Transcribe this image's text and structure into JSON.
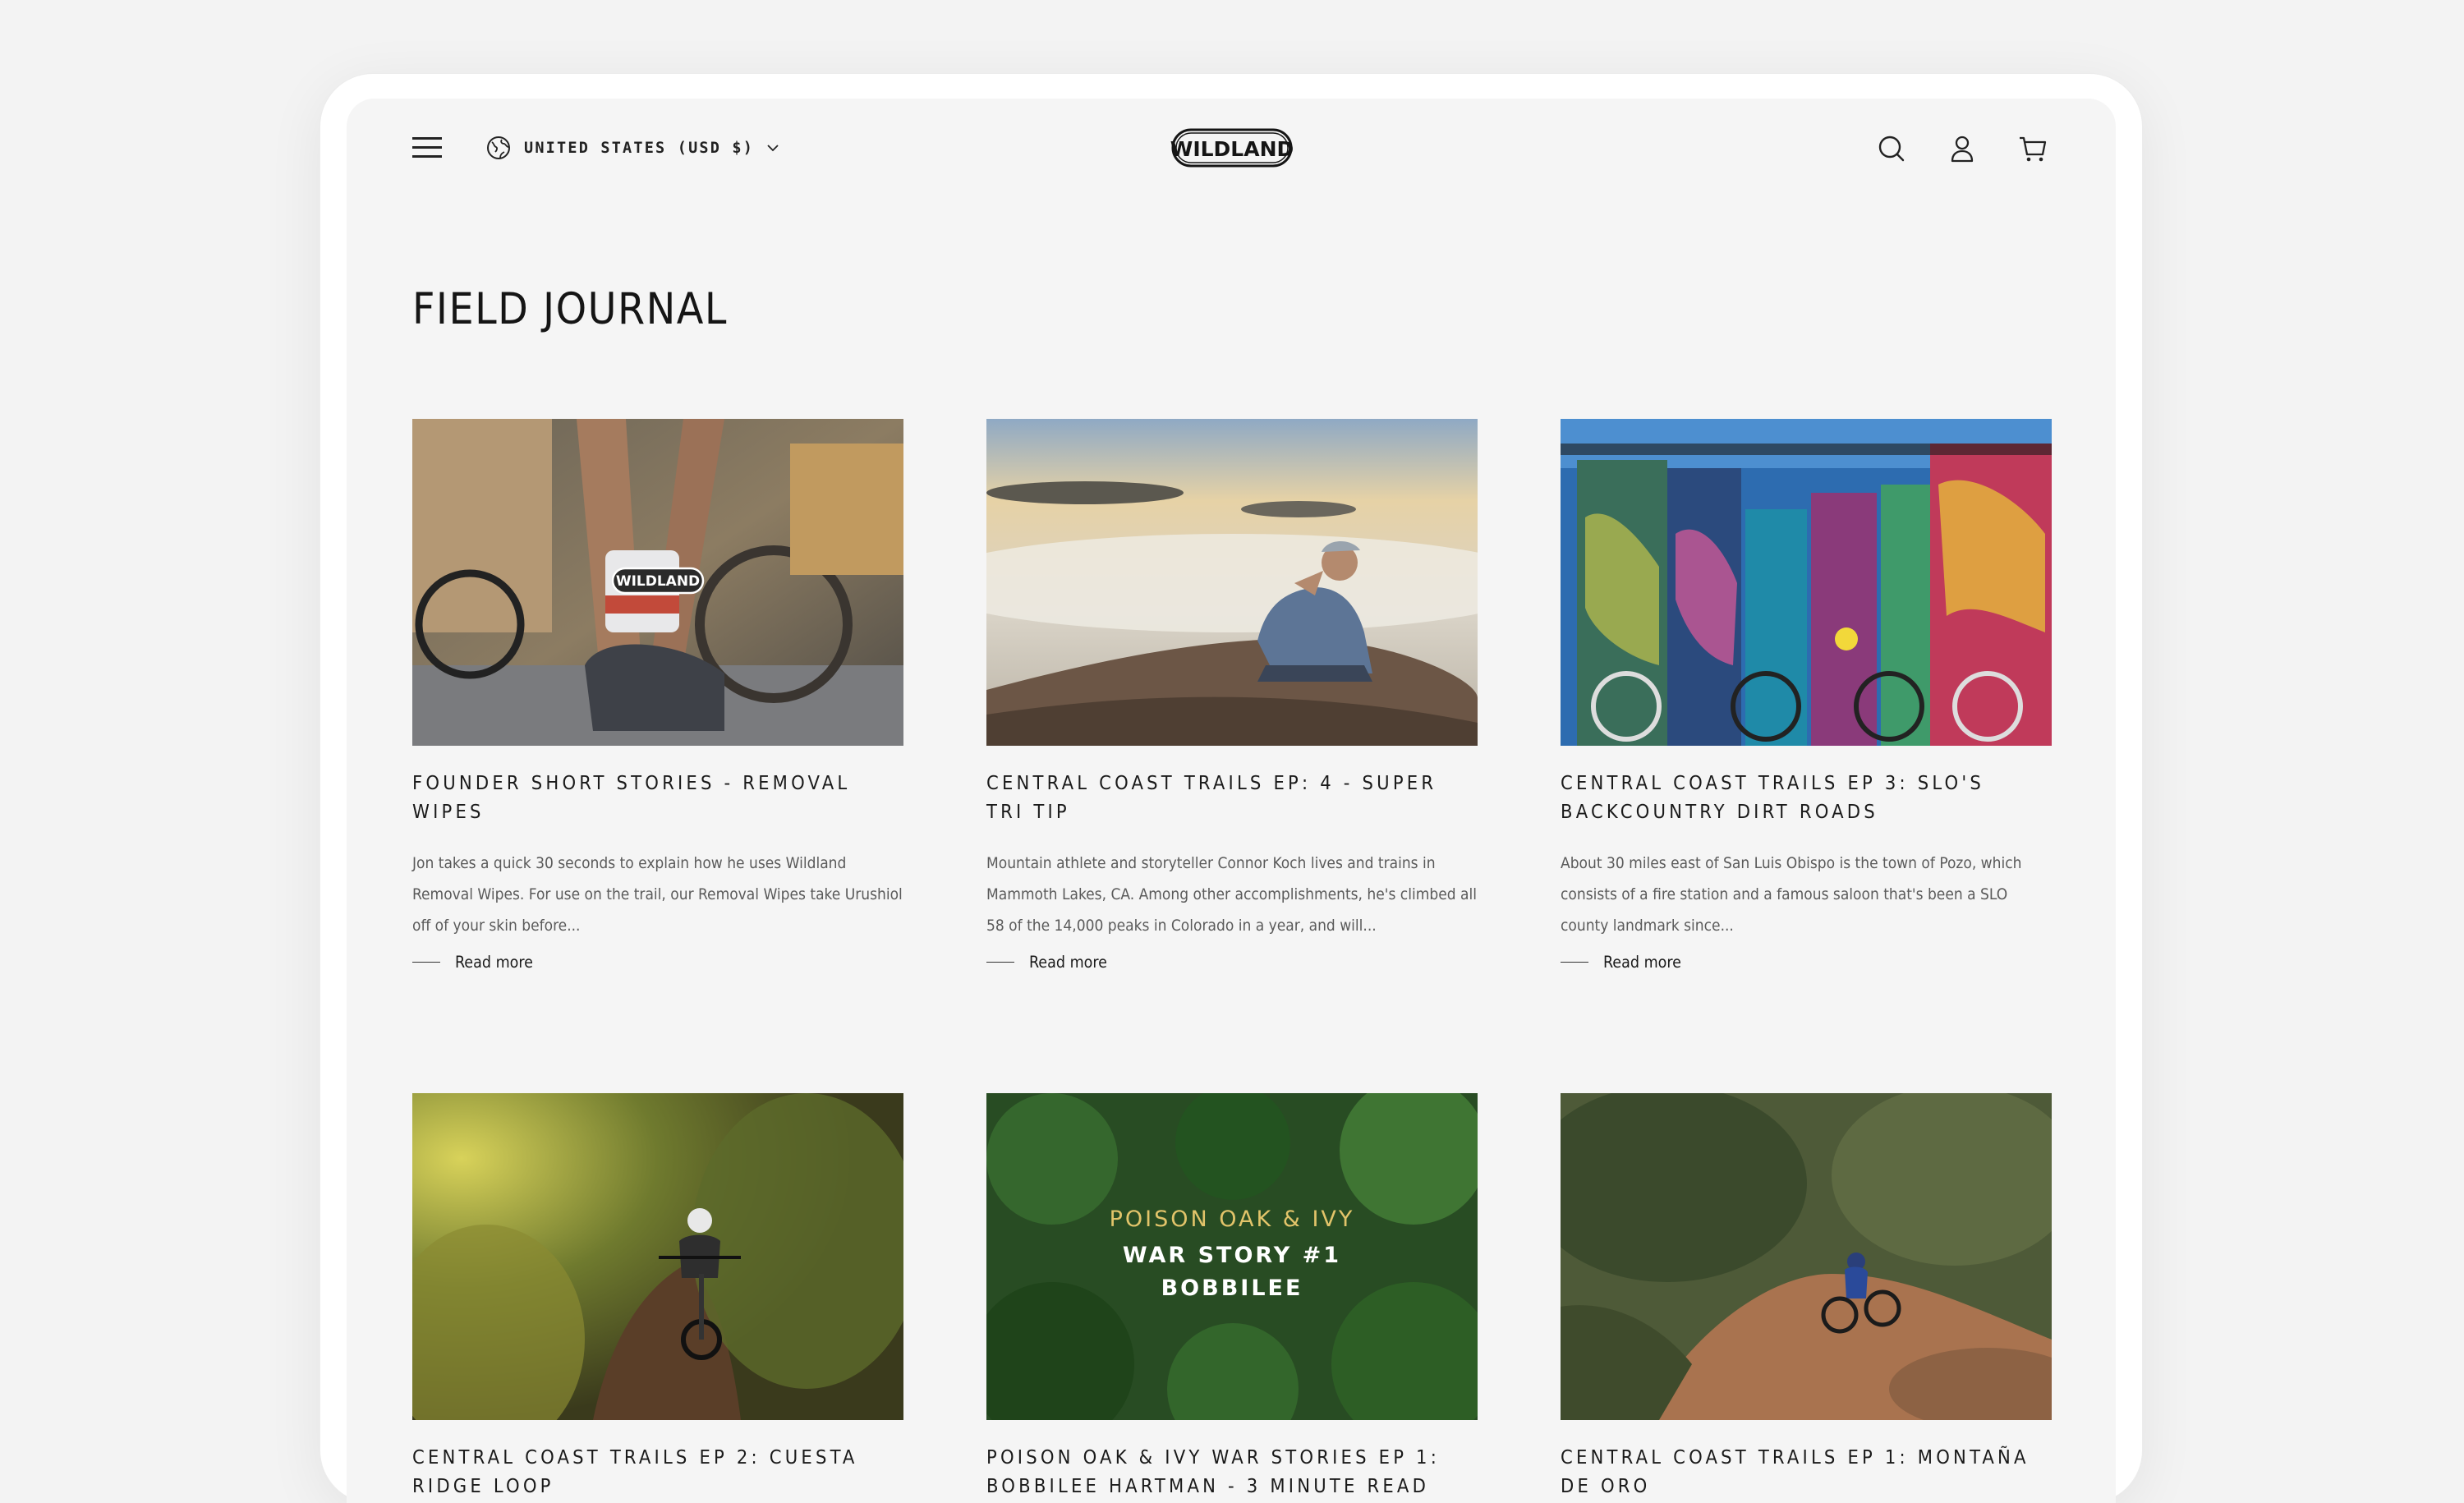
{
  "header": {
    "locale_label": "UNITED STATES (USD $)",
    "logo_text": "WILDLAND"
  },
  "page_title": "FIELD JOURNAL",
  "articles": [
    {
      "title": "FOUNDER SHORT STORIES - REMOVAL WIPES",
      "excerpt": "Jon takes a quick 30 seconds to explain how he uses Wildland Removal Wipes.  For use on the trail, our Removal Wipes take Urushiol off of your skin before...",
      "read_more": "Read more",
      "image_badge": "WILDLAND"
    },
    {
      "title": "CENTRAL COAST TRAILS EP: 4 - SUPER TRI TIP",
      "excerpt": "Mountain athlete and storyteller Connor Koch lives and trains in Mammoth Lakes, CA. Among other accomplishments, he's climbed all 58 of the 14,000 peaks in Colorado in a year, and will...",
      "read_more": "Read more"
    },
    {
      "title": "CENTRAL COAST TRAILS EP 3: SLO'S BACKCOUNTRY DIRT ROADS",
      "excerpt": "About 30 miles east of San Luis Obispo is the town of Pozo, which consists of a fire station and a famous saloon that's been a SLO county landmark since...",
      "read_more": "Read more"
    },
    {
      "title": "CENTRAL COAST TRAILS EP 2: CUESTA RIDGE LOOP"
    },
    {
      "title": "POISON OAK & IVY WAR STORIES EP 1: BOBBILEE HARTMAN - 3 MINUTE READ",
      "image_overlay": {
        "line1": "POISON OAK & IVY",
        "line2": "WAR STORY #1",
        "line3": "BOBBILEE"
      }
    },
    {
      "title": "CENTRAL COAST TRAILS EP 1: MONTAÑA DE ORO"
    }
  ]
}
